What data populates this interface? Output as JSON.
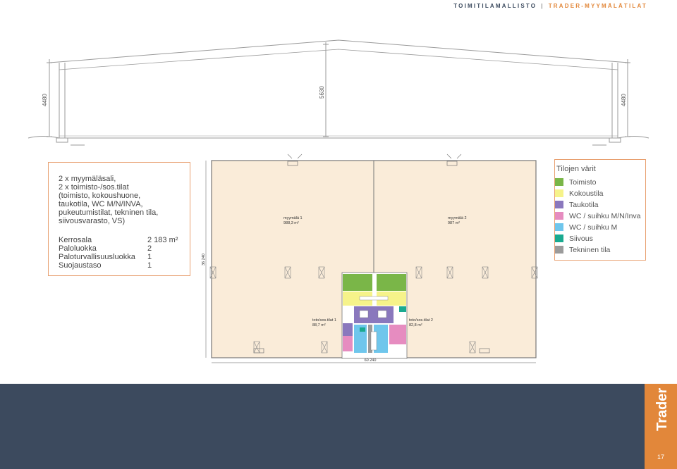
{
  "header": {
    "left": "TOIMITILAMALLISTO",
    "separator": "|",
    "right": "TRADER-MYYMÄLÄTILAT"
  },
  "section": {
    "dims": {
      "left_height": "4480",
      "ridge_height": "5630",
      "right_height": "4480"
    }
  },
  "specs": {
    "description": "2 x myymäläsali,\n2 x toimisto-/sos.tilat\n(toimisto, kokoushuone,\ntaukotila, WC M/N/INVA,\npukeutumistilat, tekninen tila,\nsiivousvarasto, VS)",
    "rows": [
      {
        "label": "Kerrosala",
        "value": "2 183 m²"
      },
      {
        "label": "Paloluokka",
        "value": "2"
      },
      {
        "label": "Paloturvallisuusluokka",
        "value": "1"
      },
      {
        "label": "Suojaustaso",
        "value": "1"
      }
    ]
  },
  "plan": {
    "width_dim": "60 240",
    "depth_dim": "36 240",
    "store1": {
      "name": "myymälä 1",
      "area": "988,3 m²"
    },
    "store2": {
      "name": "myymälä 2",
      "area": "987 m²"
    },
    "office1": {
      "name": "toto/sos.tilat 1",
      "area": "88,7 m²"
    },
    "office2": {
      "name": "toto/sos.tilat 2",
      "area": "82,8 m²"
    }
  },
  "legend": {
    "title": "Tilojen värit",
    "items": [
      {
        "label": "Toimisto",
        "color": "#7ab648"
      },
      {
        "label": "Kokoustila",
        "color": "#f6f38a"
      },
      {
        "label": "Taukotila",
        "color": "#8a78bd"
      },
      {
        "label": "WC / suihku M/N/Inva",
        "color": "#e68cc0"
      },
      {
        "label": "WC / suihku M",
        "color": "#6fc6ec"
      },
      {
        "label": "Siivous",
        "color": "#1aaa90"
      },
      {
        "label": "Tekninen tila",
        "color": "#9b9b9b"
      }
    ]
  },
  "footer": {
    "brand": "Trader",
    "page": "17"
  }
}
